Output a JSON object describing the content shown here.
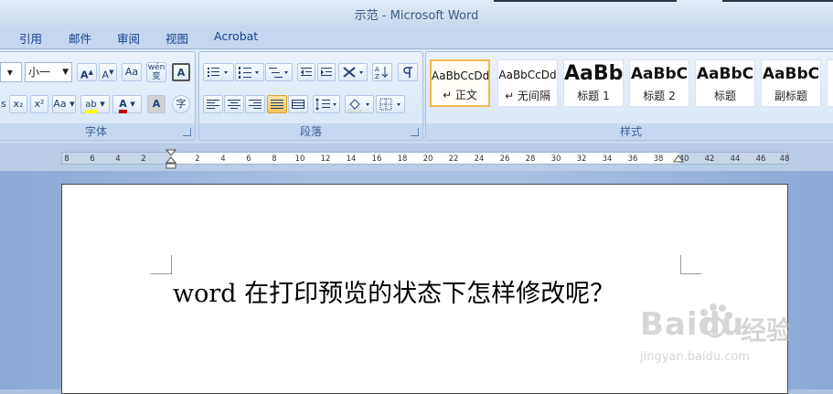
{
  "window": {
    "title": "示范 - Microsoft Word"
  },
  "tabs": [
    "引用",
    "邮件",
    "审阅",
    "视图",
    "Acrobat"
  ],
  "font_group": {
    "label": "字体",
    "size_value": "小一",
    "buttons": [
      "A",
      "A",
      "Aa",
      "wén 变",
      "A",
      "x₂",
      "x²",
      "Aa",
      "ab",
      "A",
      "A",
      "字"
    ]
  },
  "paragraph_group": {
    "label": "段落"
  },
  "styles_group": {
    "label": "样式",
    "items": [
      {
        "sample": "AaBbCcDd",
        "name": "↵ 正文"
      },
      {
        "sample": "AaBbCcDd",
        "name": "↵ 无间隔"
      },
      {
        "sample": "AaBb",
        "name": "标题 1"
      },
      {
        "sample": "AaBbC",
        "name": "标题 2"
      },
      {
        "sample": "AaBbC",
        "name": "标题"
      },
      {
        "sample": "AaBbC",
        "name": "副标题"
      }
    ]
  },
  "ruler": {
    "ticks": [
      "8",
      "6",
      "4",
      "2",
      "2",
      "4",
      "6",
      "8",
      "10",
      "12",
      "14",
      "16",
      "18",
      "20",
      "22",
      "24",
      "26",
      "28",
      "30",
      "32",
      "34",
      "36",
      "38",
      "40",
      "42",
      "44",
      "46",
      "48"
    ]
  },
  "document": {
    "text": "word 在打印预览的状态下怎样修改呢？"
  },
  "watermark": {
    "brand": "Baidu",
    "brand_cn": "经验",
    "url": "jingyan.baidu.com"
  },
  "colors": {
    "ribbon": "#d2e2f6",
    "accent_selected": "#f2b650",
    "font_color": "#c00000",
    "highlight": "#ffff00"
  }
}
